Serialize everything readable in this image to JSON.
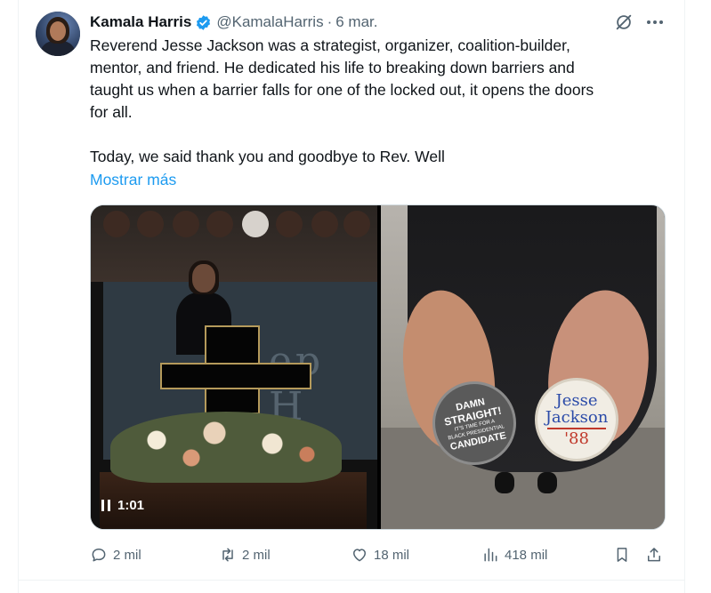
{
  "author": {
    "name": "Kamala Harris",
    "handle": "@KamalaHarris",
    "separator": "·",
    "date": "6 mar."
  },
  "tweet": {
    "lines": [
      "Reverend Jesse Jackson was a strategist, organizer, coalition-builder,",
      "mentor, and friend. He dedicated his life to breaking down barriers and",
      "taught us when a barrier falls for one of the locked out, it opens the doors",
      "for all."
    ],
    "line5": "Today, we said thank you and goodbye to Rev. Well",
    "show_more": "Mostrar más"
  },
  "media": {
    "video_time": "1:01",
    "banner_text": "ep H",
    "pin_left": {
      "line1": "DAMN",
      "line2": "STRAIGHT!",
      "line3": "IT'S TIME FOR A",
      "line4": "BLACK PRESIDENTIAL",
      "line5": "CANDIDATE"
    },
    "pin_right": {
      "line1": "Jesse",
      "line2": "Jackson",
      "year": "'88"
    }
  },
  "actions": {
    "replies": "2 mil",
    "reposts": "2 mil",
    "likes": "18 mil",
    "views": "418 mil"
  },
  "icons": {
    "verified": "verified-badge-icon",
    "grok": "grok-icon",
    "more": "more-icon",
    "reply": "reply-icon",
    "repost": "repost-icon",
    "like": "heart-icon",
    "views": "views-icon",
    "bookmark": "bookmark-icon",
    "share": "share-icon"
  },
  "colors": {
    "link": "#1d9bf0",
    "muted": "#536471",
    "text": "#0f1419"
  }
}
